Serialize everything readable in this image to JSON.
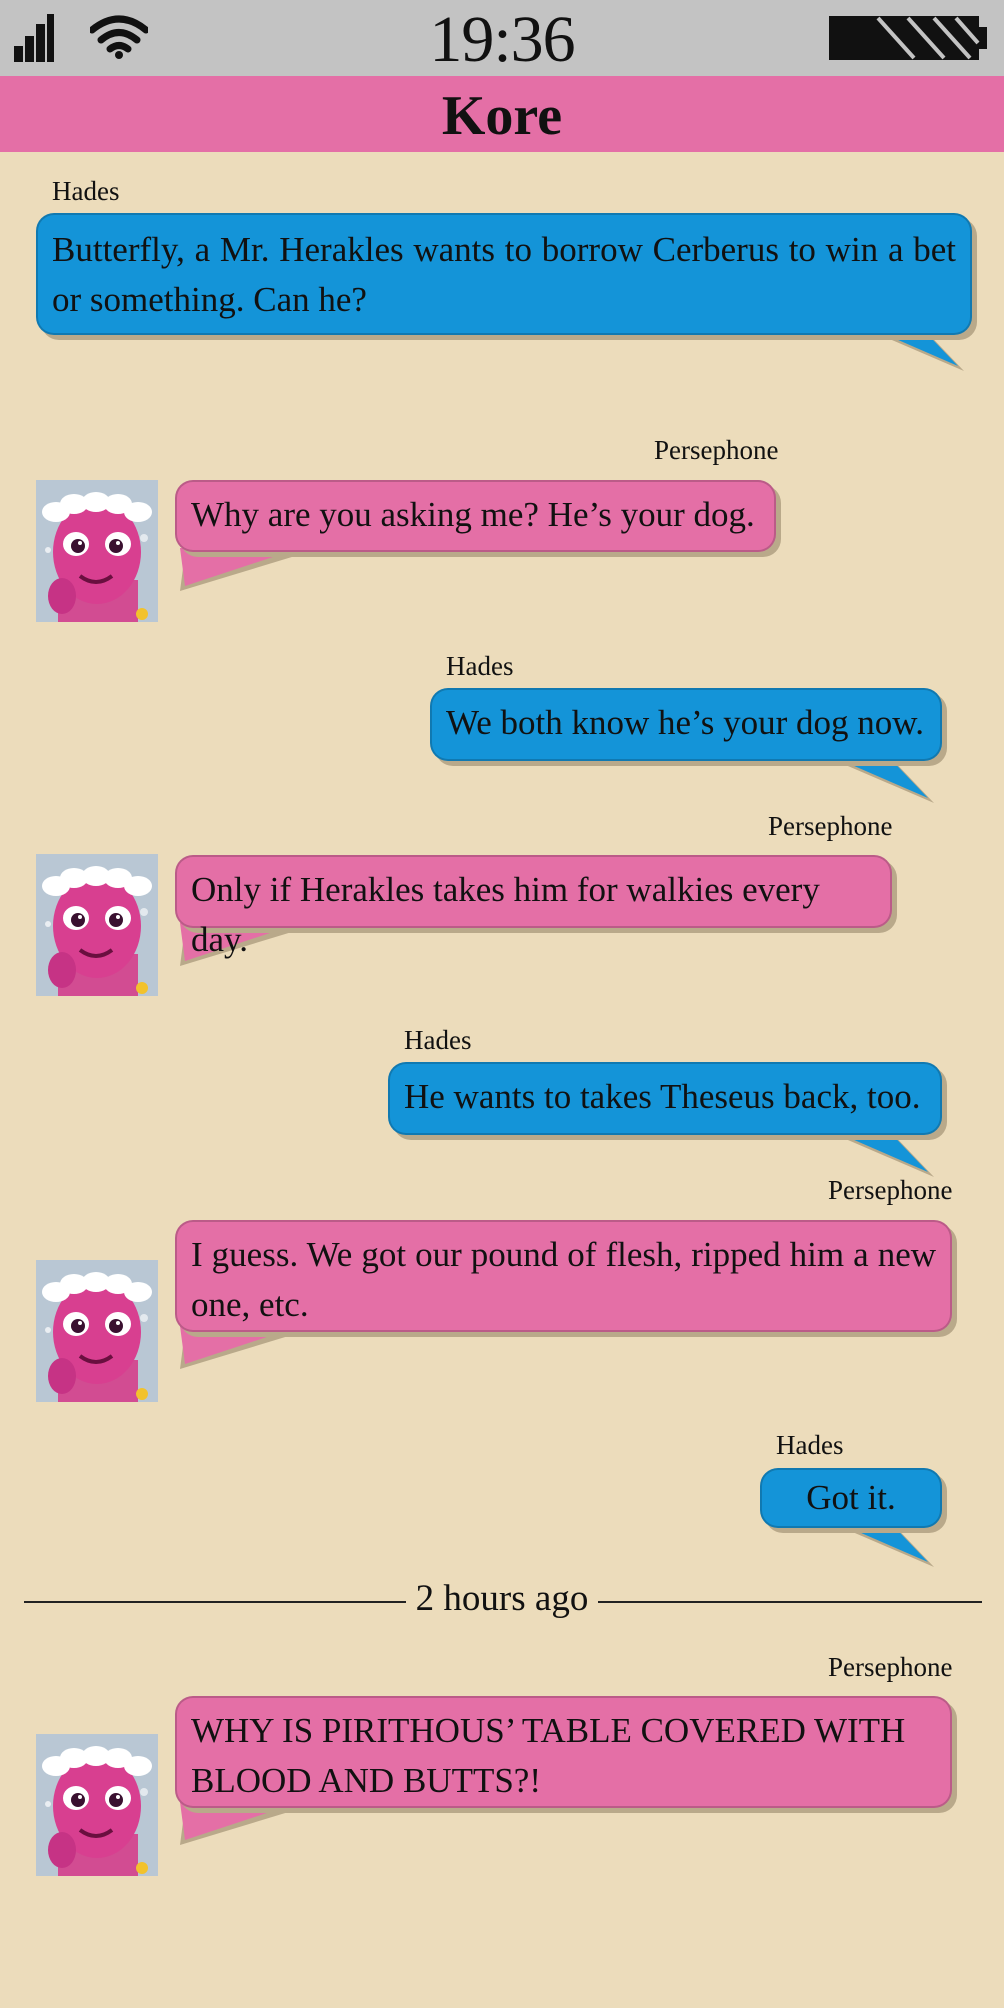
{
  "status_bar": {
    "time": "19:36",
    "signal_icon": "signal-bars-icon",
    "wifi_icon": "wifi-icon",
    "battery_icon": "battery-icon"
  },
  "header": {
    "title": "Kore"
  },
  "colors": {
    "background": "#ecdcbb",
    "status_bar": "#c3c3c3",
    "header": "#e46fa6",
    "hades_bubble": "#1494d8",
    "persephone_bubble": "#e46fa6"
  },
  "messages": [
    {
      "sender": "Hades",
      "text": "Butterfly, a Mr. Herakles wants to borrow Cerberus to win a bet or something.  Can he?"
    },
    {
      "sender": "Persephone",
      "text": "Why are you asking me?  He’s your dog."
    },
    {
      "sender": "Hades",
      "text": "We both know he’s your dog now."
    },
    {
      "sender": "Persephone",
      "text": "Only if Herakles takes him for walkies every day."
    },
    {
      "sender": "Hades",
      "text": "He wants to takes Theseus back, too."
    },
    {
      "sender": "Persephone",
      "text": "I guess.  We got our pound of flesh, ripped him a new one, etc."
    },
    {
      "sender": "Hades",
      "text": "Got it."
    },
    {
      "sender": "Persephone",
      "text": "WHY IS PIRITHOUS’ TABLE COVERED WITH BLOOD AND BUTTS?!"
    }
  ],
  "divider": {
    "text": "2 hours ago"
  }
}
